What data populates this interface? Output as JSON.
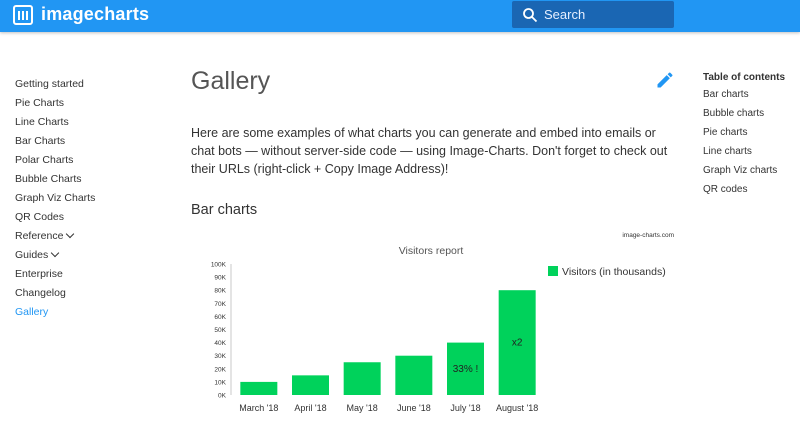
{
  "header": {
    "brand": "imagecharts",
    "search_placeholder": "Search"
  },
  "sidebar": {
    "items": [
      {
        "label": "Getting started"
      },
      {
        "label": "Pie Charts"
      },
      {
        "label": "Line Charts"
      },
      {
        "label": "Bar Charts"
      },
      {
        "label": "Polar Charts"
      },
      {
        "label": "Bubble Charts"
      },
      {
        "label": "Graph Viz Charts"
      },
      {
        "label": "QR Codes"
      },
      {
        "label": "Reference"
      },
      {
        "label": "Guides"
      },
      {
        "label": "Enterprise"
      },
      {
        "label": "Changelog"
      },
      {
        "label": "Gallery"
      }
    ]
  },
  "main": {
    "title": "Gallery",
    "intro": "Here are some examples of what charts you can generate and embed into emails or chat bots — without server-side code — using Image-Charts. Don't forget to check out their URLs (right-click + Copy Image Address)!",
    "section_title": "Bar charts"
  },
  "toc": {
    "title": "Table of contents",
    "items": [
      "Bar charts",
      "Bubble charts",
      "Pie charts",
      "Line charts",
      "Graph Viz charts",
      "QR codes"
    ]
  },
  "chart_data": {
    "type": "bar",
    "title": "Visitors report",
    "watermark": "image-charts.com",
    "categories": [
      "March '18",
      "April '18",
      "May '18",
      "June '18",
      "July '18",
      "August '18"
    ],
    "series": [
      {
        "name": "Visitors (in thousands)",
        "values": [
          10,
          15,
          25,
          30,
          40,
          80
        ]
      }
    ],
    "annotations": [
      "",
      "",
      "",
      "",
      "33% !",
      "x2"
    ],
    "ylim": [
      0,
      100
    ],
    "yticks": [
      "0K",
      "10K",
      "20K",
      "30K",
      "40K",
      "50K",
      "60K",
      "70K",
      "80K",
      "90K",
      "100K"
    ],
    "legend": "top-right",
    "bar_color": "#00d25b",
    "xlabel": "",
    "ylabel": ""
  }
}
